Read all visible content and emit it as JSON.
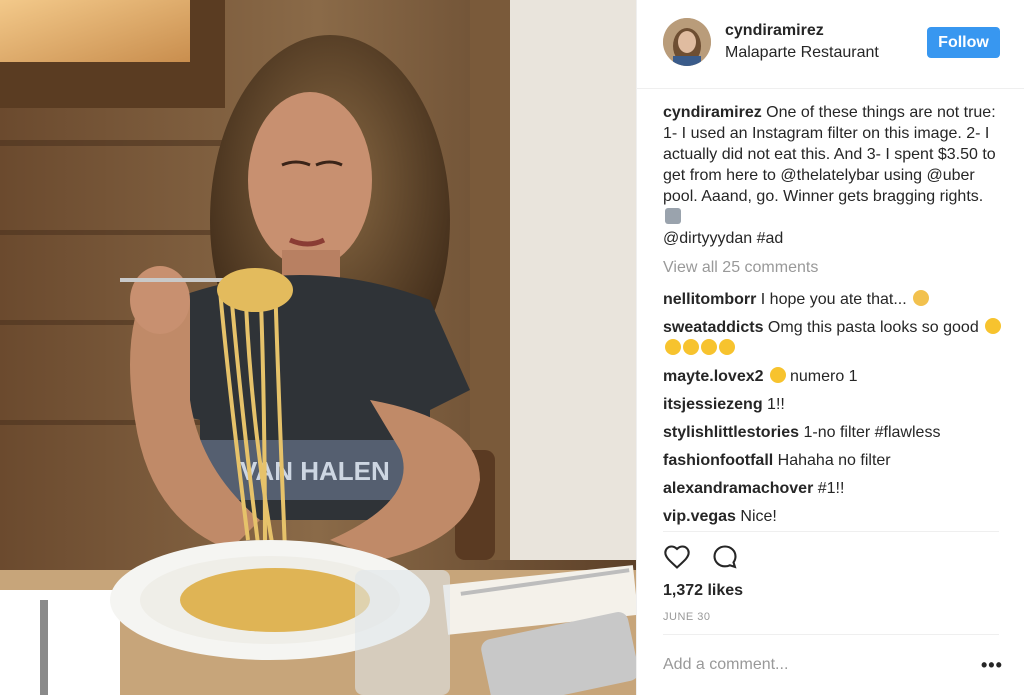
{
  "post": {
    "username": "cyndiramirez",
    "location": "Malaparte Restaurant",
    "follow_label": "Follow",
    "caption_user": "cyndiramirez",
    "caption_text": " One of these things are not true: 1- I used an Instagram filter on this image. 2- I actually did not eat this. And 3- I spent $3.50 to get from here to @thelatelybar using @uber pool. Aaand, go. Winner gets bragging rights. ",
    "caption_tail": "@dirtyyydan #ad",
    "view_all": "View all 25 comments",
    "comments": [
      {
        "user": "nellitomborr",
        "text": " I hope you ate that... "
      },
      {
        "user": "sweataddicts",
        "text": " Omg this pasta looks so good "
      },
      {
        "user": "mayte.lovex2",
        "text": " numero 1"
      },
      {
        "user": "itsjessiezeng",
        "text": " 1!!"
      },
      {
        "user": "stylishlittlestories",
        "text": " 1-no filter #flawless"
      },
      {
        "user": "fashionfootfall",
        "text": " Hahaha no filter"
      },
      {
        "user": "alexandramachover",
        "text": " #1!!"
      },
      {
        "user": "vip.vegas",
        "text": " Nice!"
      }
    ],
    "likes": "1,372 likes",
    "date": "JUNE 30",
    "add_comment_placeholder": "Add a comment...",
    "more_label": "•••"
  },
  "colors": {
    "accent": "#3897f0",
    "muted": "#999999",
    "text": "#262626"
  },
  "icons": [
    "heart-icon",
    "comment-icon",
    "more-options-icon"
  ]
}
